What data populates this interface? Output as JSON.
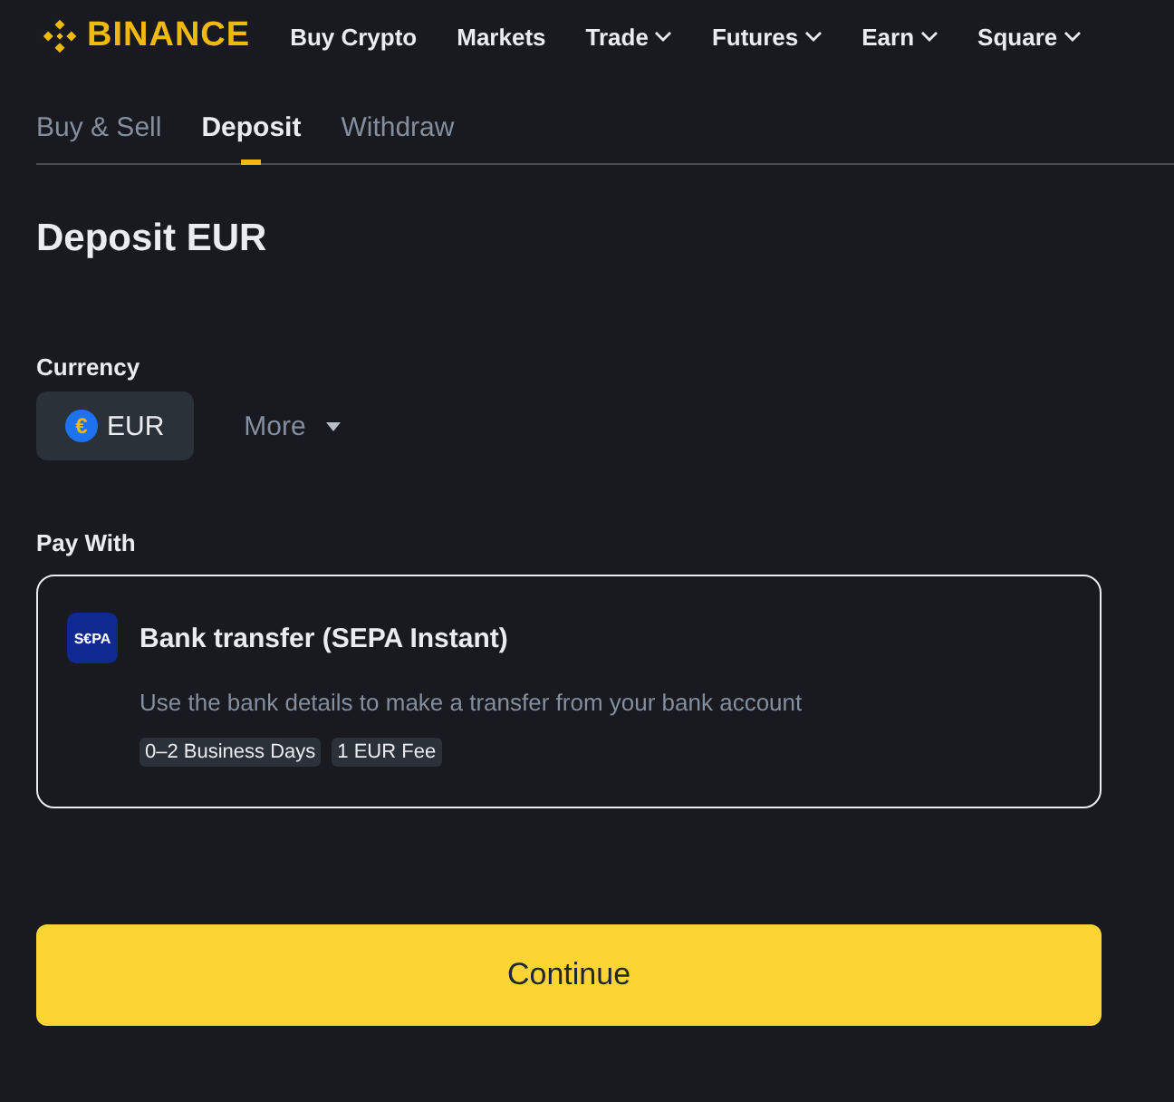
{
  "brand": {
    "name": "BINANCE"
  },
  "nav": [
    {
      "label": "Buy Crypto",
      "has_menu": false
    },
    {
      "label": "Markets",
      "has_menu": false
    },
    {
      "label": "Trade",
      "has_menu": true
    },
    {
      "label": "Futures",
      "has_menu": true
    },
    {
      "label": "Earn",
      "has_menu": true
    },
    {
      "label": "Square",
      "has_menu": true
    }
  ],
  "tabs": [
    {
      "label": "Buy & Sell",
      "selected": false
    },
    {
      "label": "Deposit",
      "selected": true
    },
    {
      "label": "Withdraw",
      "selected": false
    }
  ],
  "title": "Deposit EUR",
  "currency": {
    "label": "Currency",
    "options": [
      {
        "label": "EUR",
        "symbol": "€",
        "selected": true
      },
      {
        "label": "More",
        "selected": false
      }
    ]
  },
  "pay_with": {
    "label": "Pay With",
    "methods": [
      {
        "logo_text": "S€PA",
        "name": "Bank transfer (SEPA Instant)",
        "description": "Use the bank details to make a transfer from your bank account",
        "tags": [
          "0–2 Business Days",
          "1 EUR Fee"
        ],
        "selected": true
      }
    ]
  },
  "button": "Continue"
}
